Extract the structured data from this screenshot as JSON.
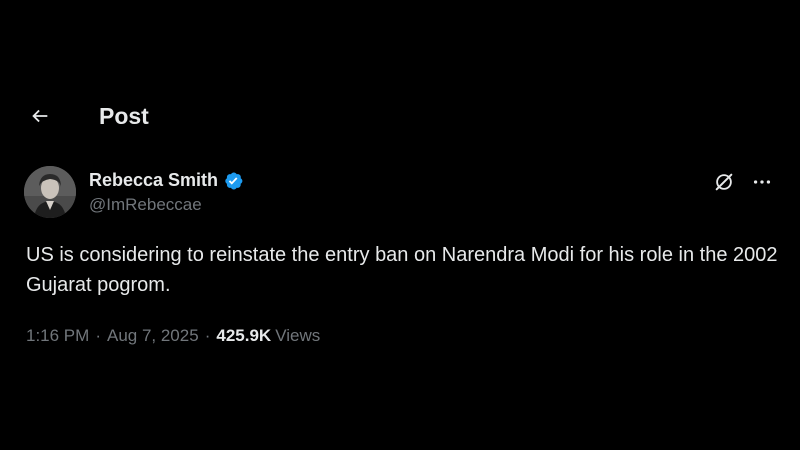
{
  "header": {
    "back_icon": "arrow-left-icon",
    "title": "Post"
  },
  "post": {
    "author": {
      "display_name": "Rebecca Smith",
      "handle": "@ImRebeccae",
      "verified": true,
      "verified_color": "#1d9bf0",
      "avatar_icon": "avatar-photo"
    },
    "actions": {
      "grok_icon": "grok-icon",
      "more_icon": "more-horizontal-icon"
    },
    "text": "US is considering to reinstate the entry ban on Narendra Modi for his role in the 2002 Gujarat pogrom.",
    "meta": {
      "time": "1:16 PM",
      "separator": "·",
      "date": "Aug 7, 2025",
      "views_count": "425.9K",
      "views_label": "Views"
    }
  },
  "colors": {
    "background": "#000000",
    "primary_text": "#e7e9ea",
    "secondary_text": "#71767b",
    "accent": "#1d9bf0"
  }
}
